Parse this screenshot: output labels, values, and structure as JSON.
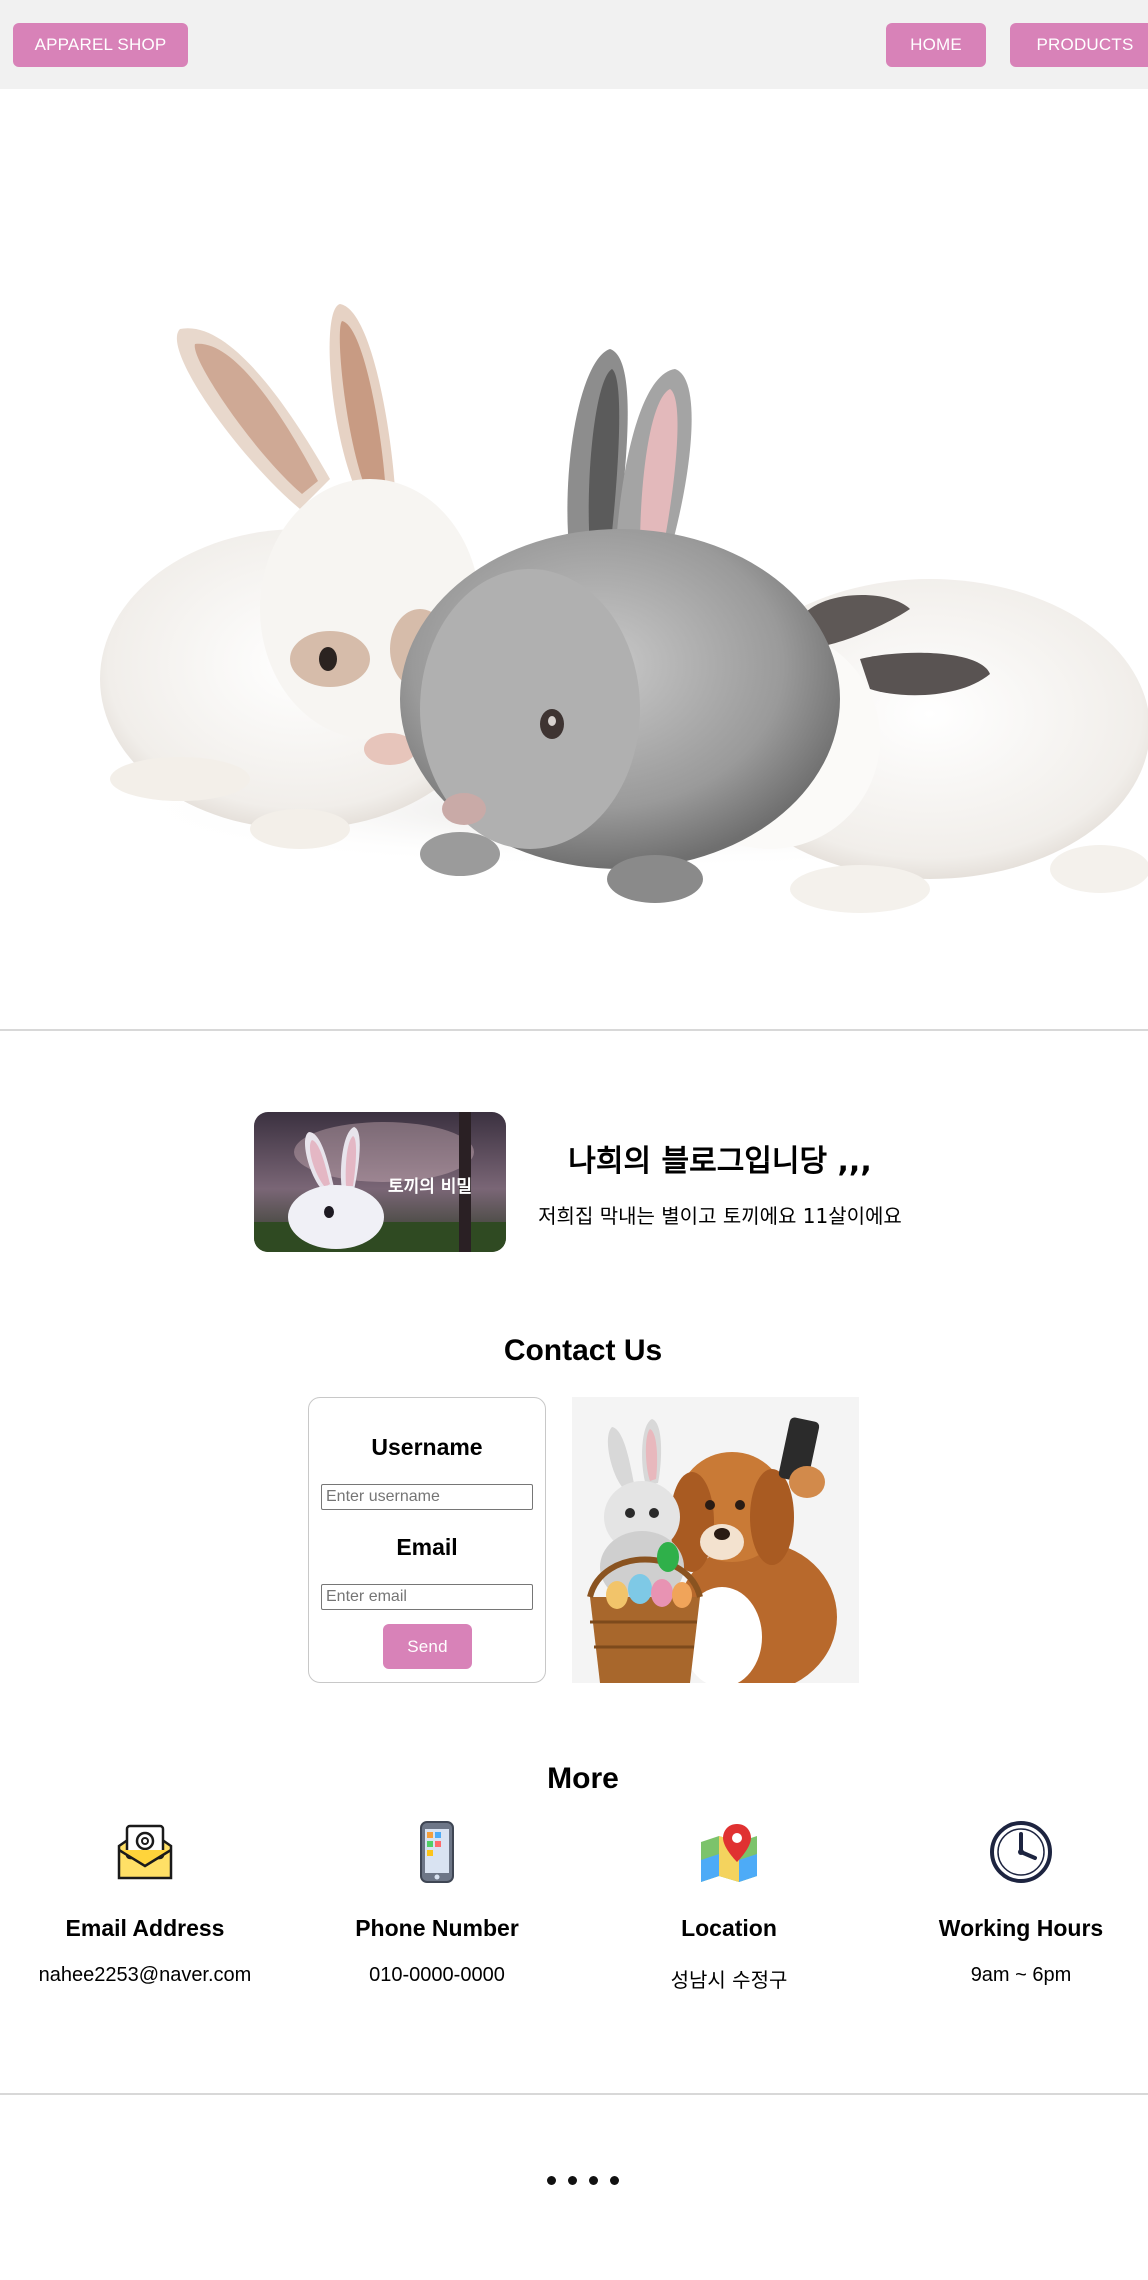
{
  "header": {
    "brand_label": "APPAREL SHOP",
    "nav": [
      {
        "label": "HOME"
      },
      {
        "label": "PRODUCTS"
      }
    ],
    "accent_color": "#d882b8",
    "background": "#f1f1f1"
  },
  "blog": {
    "thumbnail_caption": "토끼의 비밀",
    "title": "나희의 블로그입니당 ,,,",
    "description": "저희집 막내는 별이고 토끼에요 11살이에요"
  },
  "contact": {
    "title": "Contact Us",
    "username_label": "Username",
    "username_placeholder": "Enter username",
    "email_label": "Email",
    "email_placeholder": "Enter email",
    "send_label": "Send"
  },
  "more": {
    "title": "More",
    "items": [
      {
        "icon": "email-icon",
        "heading": "Email Address",
        "value": "nahee2253@naver.com"
      },
      {
        "icon": "phone-icon",
        "heading": "Phone Number",
        "value": "010-0000-0000"
      },
      {
        "icon": "map-location-icon",
        "heading": "Location",
        "value": "성남시 수정구"
      },
      {
        "icon": "clock-icon",
        "heading": "Working Hours",
        "value": "9am ~ 6pm"
      }
    ]
  },
  "pager": {
    "count": 4
  }
}
